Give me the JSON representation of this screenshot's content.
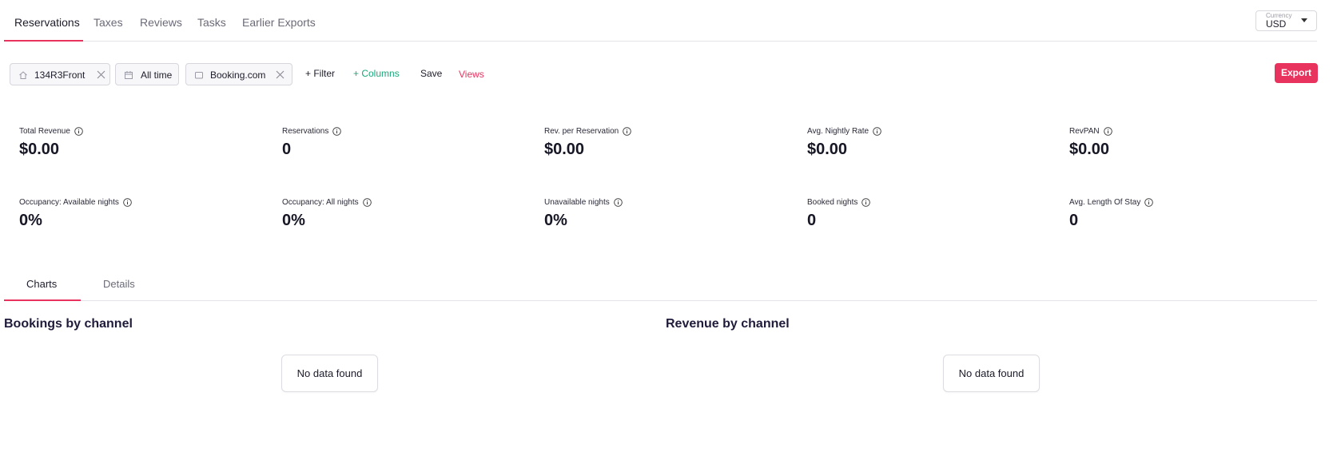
{
  "top_tabs": [
    "Reservations",
    "Taxes",
    "Reviews",
    "Tasks",
    "Earlier Exports"
  ],
  "currency": {
    "label": "Currency",
    "value": "USD"
  },
  "filters": {
    "property_chip": "134R3Front",
    "date_chip": "All time",
    "channel_chip": "Booking.com",
    "filter_link": "+ Filter",
    "columns_link": "+ Columns",
    "save_link": "Save",
    "views_link": "Views",
    "export_button": "Export"
  },
  "metrics": [
    {
      "label": "Total Revenue",
      "value": "$0.00"
    },
    {
      "label": "Reservations",
      "value": "0"
    },
    {
      "label": "Rev. per Reservation",
      "value": "$0.00"
    },
    {
      "label": "Avg. Nightly Rate",
      "value": "$0.00"
    },
    {
      "label": "RevPAN",
      "value": "$0.00"
    },
    {
      "label": "Occupancy: Available nights",
      "value": "0%"
    },
    {
      "label": "Occupancy: All nights",
      "value": "0%"
    },
    {
      "label": "Unavailable nights",
      "value": "0%"
    },
    {
      "label": "Booked nights",
      "value": "0"
    },
    {
      "label": "Avg. Length Of Stay",
      "value": "0"
    }
  ],
  "lower_tabs": [
    "Charts",
    "Details"
  ],
  "charts": [
    {
      "title": "Bookings by channel",
      "empty_text": "No data found"
    },
    {
      "title": "Revenue by channel",
      "empty_text": "No data found"
    }
  ],
  "colors": {
    "accent": "#e8335e",
    "columns_link": "#1aa87a"
  }
}
